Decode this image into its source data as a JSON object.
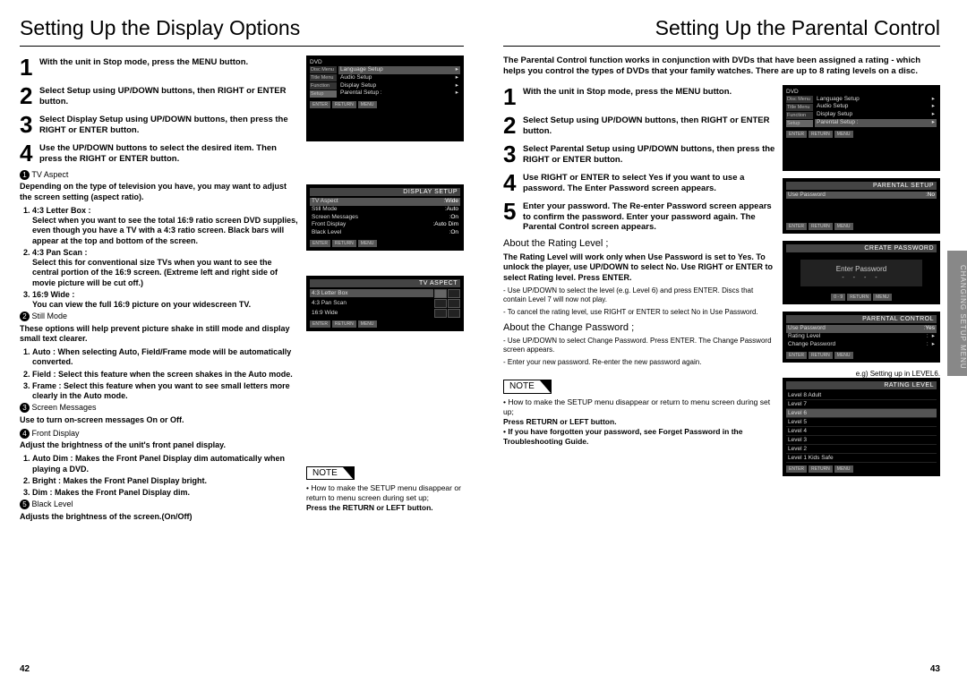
{
  "left": {
    "title": "Setting Up the Display Options",
    "steps": [
      {
        "n": "1",
        "text": "With the unit in Stop mode, press the MENU button."
      },
      {
        "n": "2",
        "text": "Select Setup using UP/DOWN buttons, then RIGHT or ENTER button."
      },
      {
        "n": "3",
        "text": "Select Display Setup using UP/DOWN buttons, then press the RIGHT or ENTER button."
      },
      {
        "n": "4",
        "text": "Use the UP/DOWN buttons to select the desired item. Then press the RIGHT or ENTER button."
      }
    ],
    "tv_aspect": {
      "num": "1",
      "label": "TV Aspect",
      "intro": "Depending on the type of television you have, you may want to adjust the screen setting (aspect ratio).",
      "items": [
        {
          "h": "4:3 Letter Box :",
          "t": "Select when you want to see the total 16:9 ratio screen DVD supplies, even though you have a TV with a 4:3 ratio screen. Black bars will appear at the top and bottom of the screen."
        },
        {
          "h": "4:3 Pan Scan :",
          "t": "Select this for conventional size TVs when you want to see the central portion of the 16:9 screen. (Extreme left and right side of movie picture will be cut off.)"
        },
        {
          "h": "16:9 Wide :",
          "t": "You can view the full 16:9 picture on your widescreen TV."
        }
      ]
    },
    "still_mode": {
      "num": "2",
      "label": "Still Mode",
      "intro": "These options will help prevent picture shake in still mode and display small text clearer.",
      "items": [
        "Auto : When selecting Auto, Field/Frame mode will be automatically converted.",
        "Field : Select this feature when the screen shakes in the Auto mode.",
        "Frame : Select this feature when you want to see small letters more clearly in the Auto mode."
      ]
    },
    "screen_messages": {
      "num": "3",
      "label": "Screen Messages",
      "text": "Use to turn on-screen messages On or Off."
    },
    "front_display": {
      "num": "4",
      "label": "Front Display",
      "intro": "Adjust the brightness of the unit's front panel display.",
      "items": [
        "Auto Dim : Makes the Front Panel Display dim automatically when playing a DVD.",
        "Bright : Makes the Front Panel Display bright.",
        "Dim : Makes the Front Panel Display dim."
      ]
    },
    "black_level": {
      "num": "5",
      "label": "Black Level",
      "text": "Adjusts the brightness of the screen.(On/Off)"
    },
    "note": {
      "label": "NOTE",
      "bullet": "How to make the SETUP menu disappear or return to menu screen during set up;",
      "line": "Press the RETURN or LEFT button."
    },
    "page_no": "42",
    "shots": {
      "setup": {
        "tag": "DVD",
        "items": [
          "Language Setup",
          "Audio Setup",
          "Display Setup",
          "Parental Setup :"
        ],
        "tabs": [
          "Disc Menu",
          "Title Menu",
          "Function",
          "Setup"
        ]
      },
      "display_setup": {
        "hdr": "DISPLAY SETUP",
        "rows": [
          [
            "TV Aspect",
            "Wide"
          ],
          [
            "Still Mode",
            "Auto"
          ],
          [
            "Screen Messages",
            "On"
          ],
          [
            "Front Display",
            "Auto Dim"
          ],
          [
            "Black Level",
            "On"
          ]
        ]
      },
      "tv_aspect": {
        "hdr": "TV ASPECT",
        "items": [
          "4:3 Letter Box",
          "4:3 Pan Scan",
          "16:9 Wide"
        ]
      }
    }
  },
  "right": {
    "title": "Setting Up the Parental Control",
    "intro": "The Parental Control function works in conjunction with DVDs that have been assigned a rating - which helps you control the types of DVDs that your family watches. There are up to 8 rating levels on a disc.",
    "steps": [
      {
        "n": "1",
        "text": "With the unit in Stop mode, press the MENU button."
      },
      {
        "n": "2",
        "text": "Select Setup using UP/DOWN buttons, then RIGHT or ENTER button."
      },
      {
        "n": "3",
        "text": "Select Parental Setup using UP/DOWN buttons, then press the RIGHT or ENTER button."
      },
      {
        "n": "4",
        "text": "Use RIGHT or ENTER to select Yes if you want to use a password. The Enter Password screen appears."
      },
      {
        "n": "5",
        "text": "Enter your password. The Re-enter Password screen appears to confirm the password. Enter your password again. The Parental Control screen appears."
      }
    ],
    "about_rating": {
      "head": "About the Rating Level ;",
      "para": "The Rating Level will work only when Use Password is set to Yes. To unlock the player, use UP/DOWN to select No. Use RIGHT or ENTER to select Rating level. Press ENTER.",
      "bullets": [
        "Use UP/DOWN to select the level (e.g. Level 6) and press ENTER. Discs that contain Level 7 will now not play.",
        "To cancel the rating level, use RIGHT or ENTER to select No in Use Password."
      ]
    },
    "about_change": {
      "head": "About the Change Password ;",
      "bullets": [
        "Use UP/DOWN to select Change Password. Press ENTER. The Change Password screen appears.",
        "Enter your new password. Re-enter the new password again."
      ]
    },
    "note": {
      "label": "NOTE",
      "bullet": "How to make the SETUP menu disappear or return to menu screen during set up;",
      "line": "Press RETURN or LEFT button.",
      "extra": "If you have forgotten your password, see Forget Password in the Troubleshooting Guide."
    },
    "eg": "e.g) Setting up in LEVEL6.",
    "page_no": "43",
    "sidetab": "CHANGING\nSETUP MENU",
    "shots": {
      "setup": {
        "tag": "DVD",
        "items": [
          "Language Setup",
          "Audio Setup",
          "Display Setup",
          "Parental Setup :"
        ],
        "tabs": [
          "Disc Menu",
          "Title Menu",
          "Function",
          "Setup"
        ]
      },
      "parental_setup": {
        "hdr": "PARENTAL SETUP",
        "row": [
          "Use Password",
          "No"
        ]
      },
      "create_pw": {
        "hdr": "CREATE PASSWORD",
        "label": "Enter Password",
        "dashes": "- - - -"
      },
      "parental_control": {
        "hdr": "PARENTAL CONTROL",
        "rows": [
          [
            "Use Password",
            "Yes"
          ],
          [
            "Rating Level",
            ""
          ],
          [
            "Change Password",
            ""
          ]
        ]
      },
      "rating_level": {
        "hdr": "RATING LEVEL",
        "items": [
          "Level 8 Adult",
          "Level 7",
          "Level 6",
          "Level 5",
          "Level 4",
          "Level 3",
          "Level 2",
          "Level 1 Kids Safe"
        ]
      }
    }
  }
}
